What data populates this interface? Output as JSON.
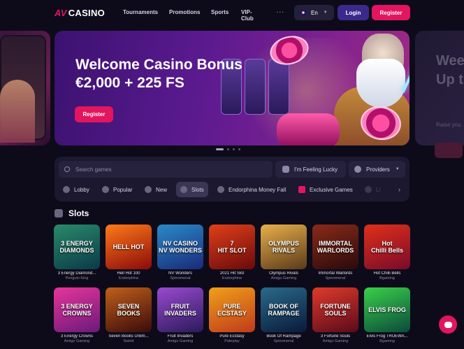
{
  "header": {
    "logo_mark": "AV",
    "logo_text": "CASINO",
    "nav": [
      "Tournaments",
      "Promotions",
      "Sports",
      "VIP-Club",
      "···"
    ],
    "language": "En",
    "login_label": "Login",
    "register_label": "Register"
  },
  "banner": {
    "title": "Welcome Casino Bonus",
    "subtitle": "€2,000 + 225 FS",
    "register_label": "Register",
    "next_title": "Wee\nUp t",
    "next_sub": "Raise you",
    "slide_count": 4,
    "active_slide": 1
  },
  "search": {
    "placeholder": "Search games",
    "lucky_label": "I'm Feeling Lucky",
    "providers_label": "Providers"
  },
  "tabs": [
    "Lobby",
    "Popular",
    "New",
    "Slots",
    "Endorphina Money Fall",
    "Exclusive Games",
    "Li"
  ],
  "active_tab": "Slots",
  "section": {
    "title": "Slots"
  },
  "games": [
    {
      "name": "3 Energy Diamond...",
      "provider": "Penguin King",
      "art": "3 ENERGY\nDIAMONDS",
      "c1": "#2a8a6a",
      "c2": "#0a3a4a"
    },
    {
      "name": "Hell Hot 100",
      "provider": "Endorphina",
      "art": "HELL HOT",
      "c1": "#ff7a1a",
      "c2": "#8a0a0a"
    },
    {
      "name": "NV Wonders",
      "provider": "Spinomenal",
      "art": "NV CASINO\nNV WONDERS",
      "c1": "#2a8ac8",
      "c2": "#1a2a7a"
    },
    {
      "name": "2021 Hit Slot",
      "provider": "Endorphina",
      "art": "7\nHIT SLOT",
      "c1": "#e0401a",
      "c2": "#6a0a0a"
    },
    {
      "name": "Olympus Rivals",
      "provider": "Amigo Gaming",
      "art": "OLYMPUS RIVALS",
      "c1": "#e8b04a",
      "c2": "#5a3a1a"
    },
    {
      "name": "Immortal Warlords",
      "provider": "Spinomenal",
      "art": "IMMORTAL\nWARLORDS",
      "c1": "#8a2a1a",
      "c2": "#2a0a0a"
    },
    {
      "name": "Hot Chilli Bells",
      "provider": "Bgaming",
      "art": "Hot\nChilli Bells",
      "c1": "#e0301a",
      "c2": "#7a0a2a"
    },
    {
      "name": "3 Energy Crowns",
      "provider": "Amigo Gaming",
      "art": "3 ENERGY\nCROWNS",
      "c1": "#e8349a",
      "c2": "#6a1a7a"
    },
    {
      "name": "Seven Books Unlim...",
      "provider": "Swintt",
      "art": "SEVEN BOOKS",
      "c1": "#c0601a",
      "c2": "#3a0a0a"
    },
    {
      "name": "Fruit Invaders",
      "provider": "Amigo Gaming",
      "art": "FRUIT INVADERS",
      "c1": "#9a4ad0",
      "c2": "#2a1a5a"
    },
    {
      "name": "Pure Ecstasy",
      "provider": "Pateplay",
      "art": "PURE ECSTASY",
      "c1": "#f0a01a",
      "c2": "#c03a1a"
    },
    {
      "name": "Book Of Rampage",
      "provider": "Spinomenal",
      "art": "BOOK OF\nRAMPAGE",
      "c1": "#2a6a8a",
      "c2": "#0a1a3a"
    },
    {
      "name": "3 Fortune Souls",
      "provider": "Amigo Gaming",
      "art": "FORTUNE\nSOULS",
      "c1": "#e03a2a",
      "c2": "#5a0a1a"
    },
    {
      "name": "Elvis Frog TRUEWA...",
      "provider": "Bgaming",
      "art": "ELVIS FROG",
      "c1": "#3ad04a",
      "c2": "#0a4a3a"
    }
  ],
  "colors": {
    "accent": "#e3155f",
    "login": "#3b2a8c",
    "bg": "#0d0b1a",
    "panel": "#1b1830"
  }
}
